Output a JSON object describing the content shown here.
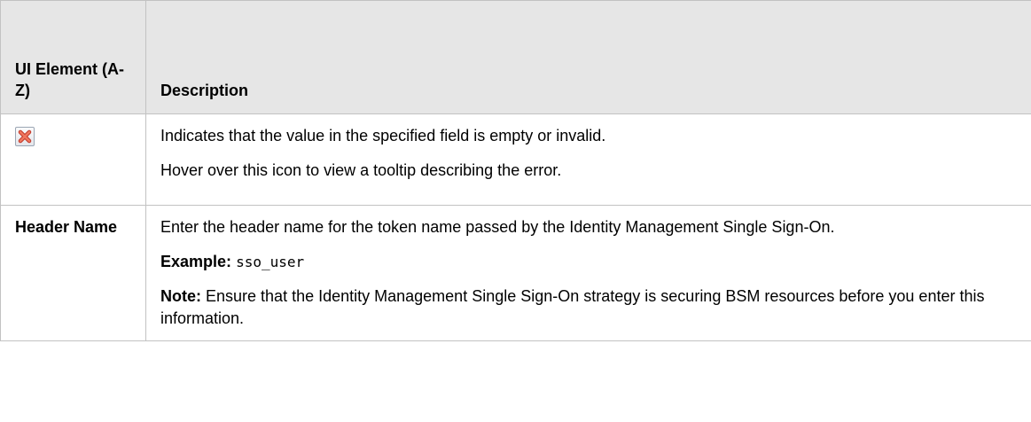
{
  "table": {
    "headers": {
      "ui_element": "UI Element (A-Z)",
      "description": "Description"
    },
    "rows": [
      {
        "element_icon": "error-x-icon",
        "description": [
          "Indicates that the value in the specified field is empty or invalid.",
          "Hover over this icon to view a tooltip describing the error."
        ]
      },
      {
        "element": "Header Name",
        "description_main": "Enter the header name for the token name passed by the Identity Management Single Sign-On.",
        "example_label": "Example:",
        "example_value": "sso_user",
        "note_label": "Note:",
        "note_text": "Ensure that the Identity Management Single Sign-On strategy is securing BSM resources before you enter this information."
      }
    ]
  },
  "colors": {
    "header_bg": "#e6e6e6",
    "border": "#c2c2c2",
    "icon_red": "#e8563f"
  }
}
